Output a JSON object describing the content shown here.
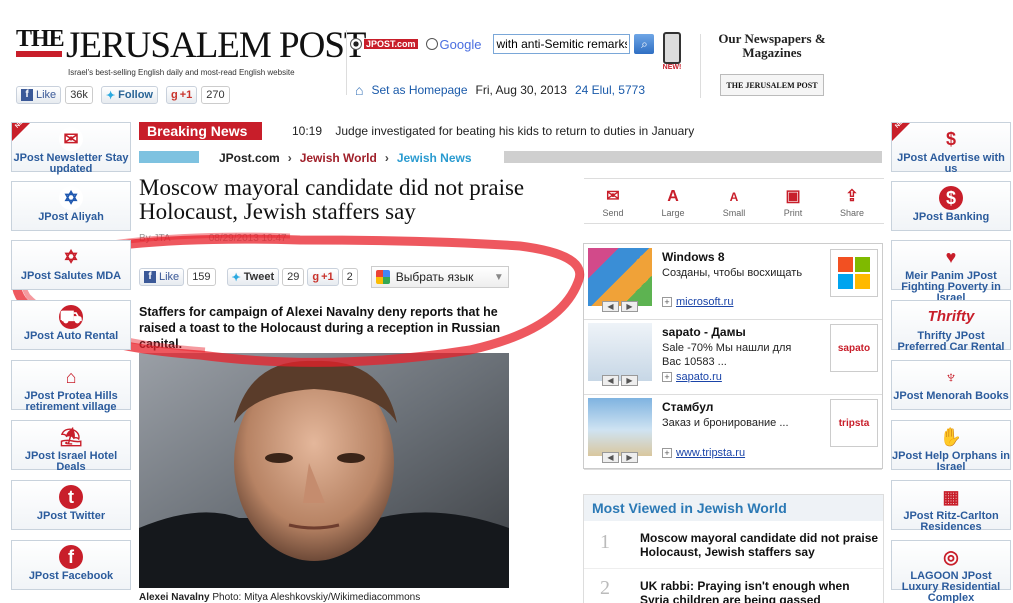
{
  "header": {
    "logo_the": "THE",
    "logo_name": "JERUSALEM POST",
    "tagline": "Israel's best-selling English daily and most-read English website",
    "search_option_jpost": "JPOST.com",
    "search_option_google": "Google",
    "search_value": "with anti-Semitic remarks",
    "new_label": "NEW!",
    "newspapers": "Our Newspapers & Magazines",
    "newspapers_logo": "THE JERUSALEM POST",
    "set_homepage": "Set as Homepage",
    "date": "Fri, Aug 30, 2013",
    "hebrew_date": "24 Elul, 5773"
  },
  "social_top": {
    "like_label": "Like",
    "like_count": "36k",
    "follow_label": "Follow",
    "gplus_label": "+1",
    "gplus_count": "270"
  },
  "breaking": {
    "label": "Breaking News",
    "time": "10:19",
    "text": "Judge investigated for beating his kids to return to duties in January"
  },
  "breadcrumb": {
    "items": [
      "JPost.com",
      "Jewish World",
      "Jewish News"
    ]
  },
  "article": {
    "title": "Moscow mayoral candidate did not praise Holocaust, Jewish staffers say",
    "byline": "By JTA",
    "datetime": "08/29/2013 10:47",
    "like_label": "Like",
    "like_count": "159",
    "tweet_label": "Tweet",
    "tweet_count": "29",
    "gplus_label": "+1",
    "gplus_count": "2",
    "translate_label": "Выбрать язык",
    "lede": "Staffers for campaign of Alexei Navalny deny reports that he raised a toast to the Holocaust during a reception in Russian capital.",
    "caption_name": "Alexei Navalny",
    "caption_credit": "Photo: Mitya Aleshkovskiy/Wikimediacommons"
  },
  "tools": [
    {
      "label": "Send",
      "icon": "envelope-icon",
      "glyph": "✉"
    },
    {
      "label": "Large",
      "icon": "font-large-icon",
      "glyph": "A"
    },
    {
      "label": "Small",
      "icon": "font-small-icon",
      "glyph": "A"
    },
    {
      "label": "Print",
      "icon": "printer-icon",
      "glyph": "▣"
    },
    {
      "label": "Share",
      "icon": "share-icon",
      "glyph": "⇪"
    }
  ],
  "ads": [
    {
      "title": "Windows 8",
      "desc": "Созданы, чтобы восхищать",
      "link": "microsoft.ru",
      "logo": "windows-logo"
    },
    {
      "title": "sapato - Дамы",
      "desc": "Sale -70% Мы нашли для Вас 10583 ...",
      "link": "sapato.ru",
      "logo": "sapato"
    },
    {
      "title": "Стамбул",
      "desc": "Заказ и бронирование ...",
      "link": "www.tripsta.ru",
      "logo": "tripsta"
    }
  ],
  "most_viewed": {
    "title": "Most Viewed in Jewish World",
    "items": [
      {
        "num": "1",
        "text": "Moscow mayoral candidate did not praise Holocaust, Jewish staffers say"
      },
      {
        "num": "2",
        "text": "UK rabbi: Praying isn't enough when Syria children are being gassed"
      }
    ]
  },
  "left_sidebar": [
    {
      "label": "JPost Newsletter Stay updated",
      "icon": "envelope-icon",
      "ribbon": "NEW"
    },
    {
      "label": "JPost Aliyah",
      "icon": "israel-flag-icon"
    },
    {
      "label": "JPost Salutes MDA",
      "icon": "star-of-david-icon"
    },
    {
      "label": "JPost Auto Rental",
      "icon": "car-icon"
    },
    {
      "label": "JPost Protea Hills retirement village",
      "icon": "houses-icon"
    },
    {
      "label": "JPost Israel Hotel Deals",
      "icon": "beach-chair-icon"
    },
    {
      "label": "JPost Twitter",
      "icon": "twitter-icon"
    },
    {
      "label": "JPost Facebook",
      "icon": "facebook-icon"
    }
  ],
  "right_sidebar": [
    {
      "label": "JPost Advertise with us",
      "icon": "dollar-icon",
      "ribbon": "NEW"
    },
    {
      "label": "JPost Banking",
      "icon": "bank-icon"
    },
    {
      "label": "Meir Panim JPost Fighting Poverty in Israel",
      "icon": "meir-panim-logo"
    },
    {
      "label": "Thrifty JPost Preferred Car Rental",
      "icon": "thrifty-logo"
    },
    {
      "label": "JPost Menorah Books",
      "icon": "menorah-icon"
    },
    {
      "label": "JPost Help Orphans in Israel",
      "icon": "hand-icon"
    },
    {
      "label": "JPost Ritz-Carlton Residences",
      "icon": "building-icon"
    },
    {
      "label": "LAGOON JPost Luxury Residential Complex",
      "icon": "lagoon-logo"
    }
  ],
  "colors": {
    "brand_red": "#c81e2a",
    "link_blue": "#1a44a8",
    "side_blue": "#2b5b9c",
    "annotation_red": "#e8202a"
  }
}
